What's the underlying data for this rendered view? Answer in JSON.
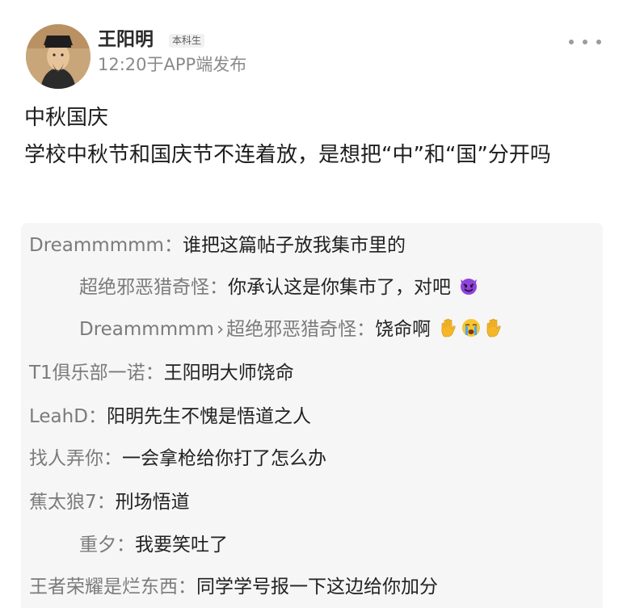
{
  "author": {
    "name": "王阳明",
    "badge": "本科生",
    "meta": "12:20于APP端发布",
    "avatar_icon": "portrait-avatar"
  },
  "post": {
    "title": "中秋国庆",
    "body": "学校中秋节和国庆节不连着放，是想把“中”和“国”分开吗"
  },
  "menu": {
    "icon": "more-dots-icon"
  },
  "comments": [
    {
      "user": "Dreammmmm",
      "sep": "：",
      "text": "谁把这篇帖子放我集市里的"
    },
    {
      "user": "超绝邪恶猎奇怪",
      "sep": "：",
      "text": "你承认这是你集市了，对吧",
      "emojis": [
        "devil-face-emoji"
      ]
    },
    {
      "user": "Dreammmmm",
      "arrow": "›",
      "target": "超绝邪恶猎奇怪",
      "sep": "：",
      "text": "饶命啊",
      "emojis": [
        "raised-hand-emoji",
        "crying-face-emoji",
        "raised-hand-emoji"
      ]
    },
    {
      "user": "T1俱乐部一诺",
      "sep": "：",
      "text": "王阳明大师饶命"
    },
    {
      "user": "LeahD",
      "sep": "：",
      "text": "阳明先生不愧是悟道之人"
    },
    {
      "user": "找人弄你",
      "sep": "：",
      "text": "一会拿枪给你打了怎么办"
    },
    {
      "user": "蕉太狼7",
      "sep": "：",
      "text": "刑场悟道"
    },
    {
      "user": "重夕",
      "sep": "：",
      "text": "我要笑吐了"
    },
    {
      "user": "王者荣耀是烂东西",
      "sep": "：",
      "text": "同学学号报一下这边给你加分"
    }
  ],
  "colors": {
    "comment_bg": "#f6f6f6",
    "username": "#7b7b7b",
    "meta": "#8a8a8a"
  }
}
